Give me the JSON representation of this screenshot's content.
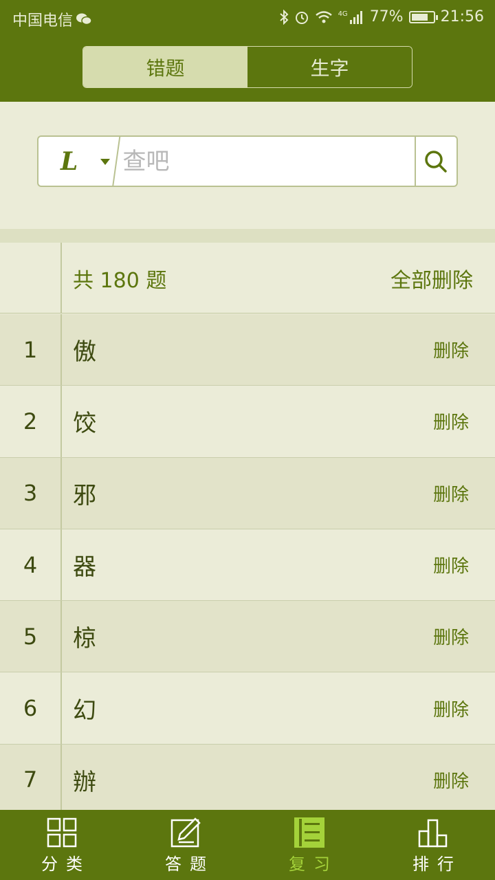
{
  "status_bar": {
    "carrier": "中国电信",
    "signal_label": "4G",
    "battery_text": "77%",
    "battery_level": 0.77,
    "time": "21:56"
  },
  "tabs": [
    {
      "label": "错题",
      "active": true
    },
    {
      "label": "生字",
      "active": false
    }
  ],
  "search": {
    "letter": "L",
    "placeholder": "查吧",
    "value": ""
  },
  "list_header": {
    "count_text": "共 180 题",
    "delete_all_label": "全部删除"
  },
  "items": [
    {
      "index": "1",
      "char": "傲",
      "delete_label": "删除"
    },
    {
      "index": "2",
      "char": "饺",
      "delete_label": "删除"
    },
    {
      "index": "3",
      "char": "邪",
      "delete_label": "删除"
    },
    {
      "index": "4",
      "char": "器",
      "delete_label": "删除"
    },
    {
      "index": "5",
      "char": "椋",
      "delete_label": "删除"
    },
    {
      "index": "6",
      "char": "幻",
      "delete_label": "删除"
    },
    {
      "index": "7",
      "char": "辦",
      "delete_label": "删除"
    }
  ],
  "bottom_nav": [
    {
      "label": "分类",
      "icon": "grid-icon",
      "active": false
    },
    {
      "label": "答题",
      "icon": "edit-icon",
      "active": false
    },
    {
      "label": "复习",
      "icon": "list-icon",
      "active": true
    },
    {
      "label": "排行",
      "icon": "ranking-icon",
      "active": false
    }
  ],
  "colors": {
    "brand": "#5c760e",
    "active_nav": "#a4d23a",
    "background": "#ebecd8"
  }
}
